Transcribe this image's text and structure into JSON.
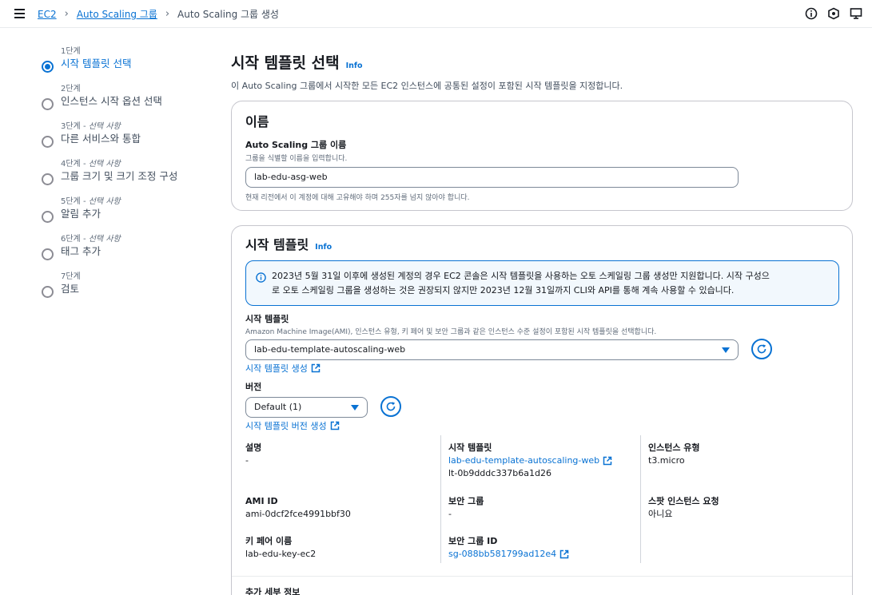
{
  "breadcrumb": {
    "items": [
      "EC2",
      "Auto Scaling 그룹"
    ],
    "current": "Auto Scaling 그룹 생성"
  },
  "steps": [
    {
      "num": "1단계",
      "optional": "",
      "name": "시작 템플릿 선택",
      "active": true
    },
    {
      "num": "2단계",
      "optional": "",
      "name": "인스턴스 시작 옵션 선택",
      "active": false
    },
    {
      "num": "3단계 - ",
      "optional": "선택 사항",
      "name": "다른 서비스와 통합",
      "active": false
    },
    {
      "num": "4단계 - ",
      "optional": "선택 사항",
      "name": "그룹 크기 및 크기 조정 구성",
      "active": false
    },
    {
      "num": "5단계 - ",
      "optional": "선택 사항",
      "name": "알림 추가",
      "active": false
    },
    {
      "num": "6단계 - ",
      "optional": "선택 사항",
      "name": "태그 추가",
      "active": false
    },
    {
      "num": "7단계",
      "optional": "",
      "name": "검토",
      "active": false
    }
  ],
  "page": {
    "title": "시작 템플릿 선택",
    "info": "Info",
    "description": "이 Auto Scaling 그룹에서 시작한 모든 EC2 인스턴스에 공통된 설정이 포함된 시작 템플릿을 지정합니다."
  },
  "name_section": {
    "title": "이름",
    "label": "Auto Scaling 그룹 이름",
    "description": "그룹을 식별할 이름을 입력합니다.",
    "value": "lab-edu-asg-web",
    "constraint": "현재 리전에서 이 계정에 대해 고유해야 하며 255자를 넘지 않아야 합니다."
  },
  "template_section": {
    "title": "시작 템플릿",
    "info": "Info",
    "alert_line1": "2023년 5월 31일 이후에 생성된 계정의 경우 EC2 콘솔은 시작 템플릿을 사용하는 오토 스케일링 그룹 생성만 지원합니다. 시작 구성으",
    "alert_line2": "로 오토 스케일링 그룹을 생성하는 것은 권장되지 않지만 2023년 12월 31일까지 CLI와 API를 통해 계속 사용할 수 있습니다.",
    "template_label": "시작 템플릿",
    "template_desc": "Amazon Machine Image(AMI), 인스턴스 유형, 키 페어 및 보안 그룹과 같은 인스턴스 수준 설정이 포함된 시작 템플릿을 선택합니다.",
    "template_value": "lab-edu-template-autoscaling-web",
    "create_template_link": "시작 템플릿 생성",
    "version_label": "버전",
    "version_value": "Default (1)",
    "create_version_link": "시작 템플릿 버전 생성",
    "details": {
      "description_key": "설명",
      "description_val": "-",
      "template_key": "시작 템플릿",
      "template_link": "lab-edu-template-autoscaling-web",
      "template_id": "lt-0b9dddc337b6a1d26",
      "instance_type_key": "인스턴스 유형",
      "instance_type_val": "t3.micro",
      "ami_key": "AMI ID",
      "ami_val": "ami-0dcf2fce4991bbf30",
      "sg_key": "보안 그룹",
      "sg_val": "-",
      "spot_key": "스팟 인스턴스 요청",
      "spot_val": "아니요",
      "keypair_key": "키 페어 이름",
      "keypair_val": "lab-edu-key-ec2",
      "sgid_key": "보안 그룹 ID",
      "sgid_link": "sg-088bb581799ad12e4"
    },
    "next_heading": "추가 세부 정보"
  },
  "colors": {
    "link": "#0972d3",
    "alert_bg": "#f2f8fd",
    "text": "#16191f"
  }
}
